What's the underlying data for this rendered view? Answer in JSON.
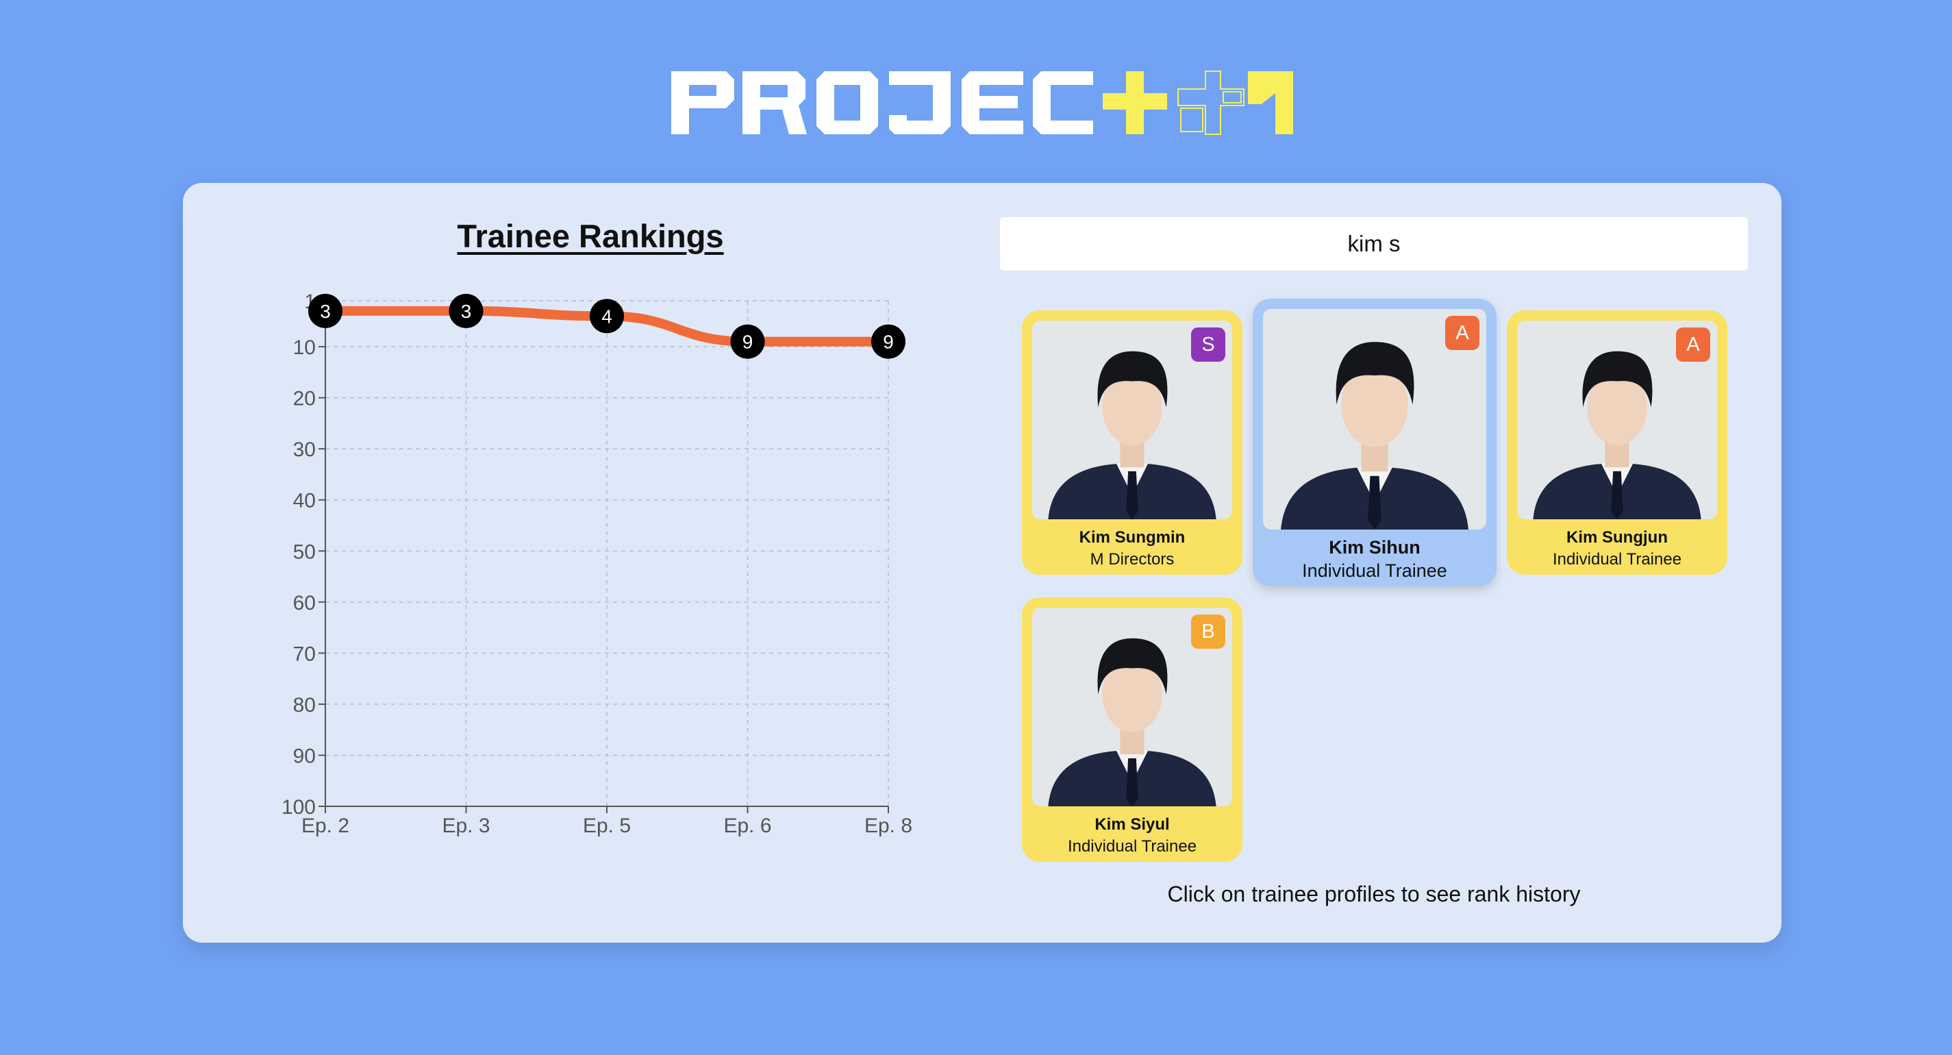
{
  "logo": {
    "text": "PROJECT 7"
  },
  "chart_title": "Trainee Rankings",
  "search": {
    "value": "kim s",
    "placeholder": ""
  },
  "hint": "Click on trainee profiles to see rank history",
  "colors": {
    "line": "#ef6b3a",
    "card": "#f9e164",
    "card_selected": "#a7c8f7"
  },
  "chart_data": {
    "type": "line",
    "title": "Trainee Rankings",
    "categories": [
      "Ep. 2",
      "Ep. 3",
      "Ep. 5",
      "Ep. 6",
      "Ep. 8"
    ],
    "series": [
      {
        "values": [
          3,
          3,
          4,
          9,
          9
        ]
      }
    ],
    "ylim": [
      1,
      100
    ],
    "y_inverted": true,
    "yticks": [
      "1",
      "10",
      "20",
      "30",
      "40",
      "50",
      "60",
      "70",
      "80",
      "90",
      "100"
    ],
    "grid": true
  },
  "trainees": [
    {
      "name": "Kim Sungmin",
      "company": "M Directors",
      "grade": "S",
      "grade_color": "#8e35b7",
      "selected": false
    },
    {
      "name": "Kim Sihun",
      "company": "Individual Trainee",
      "grade": "A",
      "grade_color": "#ef6b3a",
      "selected": true
    },
    {
      "name": "Kim Sungjun",
      "company": "Individual Trainee",
      "grade": "A",
      "grade_color": "#ef6b3a",
      "selected": false
    },
    {
      "name": "Kim Siyul",
      "company": "Individual Trainee",
      "grade": "B",
      "grade_color": "#f4a935",
      "selected": false
    }
  ]
}
